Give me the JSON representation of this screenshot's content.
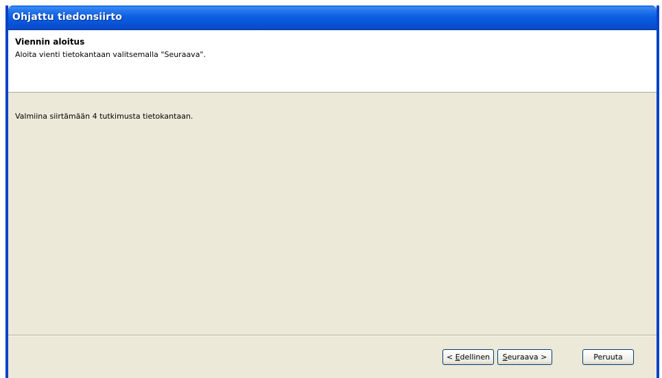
{
  "window": {
    "title": "Ohjattu tiedonsiirto"
  },
  "header": {
    "title": "Viennin aloitus",
    "subtitle": "Aloita vienti tietokantaan valitsemalla \"Seuraava\"."
  },
  "content": {
    "message": "Valmiina siirtämään 4 tutkimusta tietokantaan."
  },
  "buttons": {
    "back_prefix": "< ",
    "back_mnemonic": "E",
    "back_rest": "dellinen",
    "next_mnemonic": "S",
    "next_rest": "euraava >",
    "cancel_label": "Peruuta"
  }
}
